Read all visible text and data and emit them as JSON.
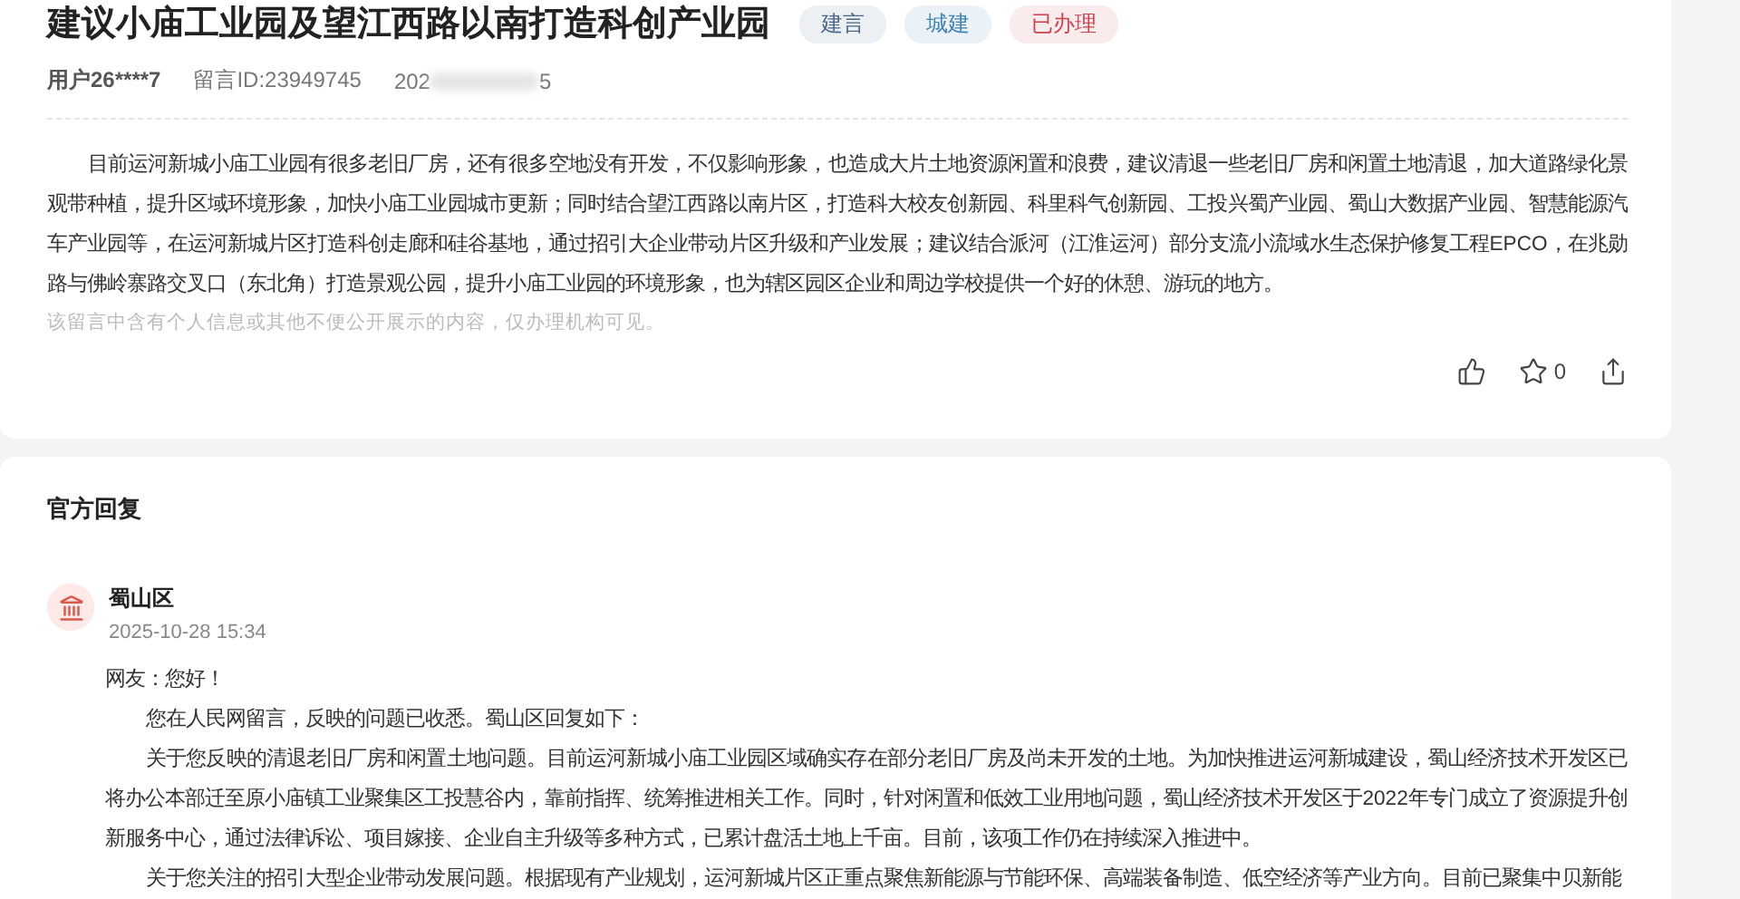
{
  "message": {
    "title": "建议小庙工业园及望江西路以南打造科创产业园",
    "tags": [
      {
        "label": "建言",
        "color": "#4a6a8a"
      },
      {
        "label": "城建",
        "color": "#3f84b0"
      },
      {
        "label": "已办理",
        "color": "#d0404a"
      }
    ],
    "user": "用户26****7",
    "message_id": "留言ID:23949745",
    "date_parts": [
      "202",
      "5"
    ],
    "body": "目前运河新城小庙工业园有很多老旧厂房，还有很多空地没有开发，不仅影响形象，也造成大片土地资源闲置和浪费，建议清退一些老旧厂房和闲置土地清退，加大道路绿化景观带种植，提升区域环境形象，加快小庙工业园城市更新；同时结合望江西路以南片区，打造科大校友创新园、科里科气创新园、工投兴蜀产业园、蜀山大数据产业园、智慧能源汽车产业园等，在运河新城片区打造科创走廊和硅谷基地，通过招引大企业带动片区升级和产业发展；建议结合派河（江淮运河）部分支流小流域水生态保护修复工程EPCO，在兆勋路与佛岭寨路交叉口（东北角）打造景观公园，提升小庙工业园的环境形象，也为辖区园区企业和周边学校提供一个好的休憩、游玩的地方。",
    "privacy_note": "该留言中含有个人信息或其他不便公开展示的内容，仅办理机构可见。",
    "star_count": "0"
  },
  "official_reply": {
    "heading": "官方回复",
    "responder": "蜀山区",
    "time": "2025-10-28 15:34",
    "greeting": "网友：您好！",
    "paragraphs": [
      "您在人民网留言，反映的问题已收悉。蜀山区回复如下：",
      "关于您反映的清退老旧厂房和闲置土地问题。目前运河新城小庙工业园区域确实存在部分老旧厂房及尚未开发的土地。为加快推进运河新城建设，蜀山经济技术开发区已将办公本部迁至原小庙镇工业聚集区工投慧谷内，靠前指挥、统筹推进相关工作。同时，针对闲置和低效工业用地问题，蜀山经济技术开发区于2022年专门成立了资源提升创新服务中心，通过法律诉讼、项目嫁接、企业自主升级等多种方式，已累计盘活土地上千亩。目前，该项工作仍在持续深入推进中。",
      "关于您关注的招引大型企业带动发展问题。根据现有产业规划，运河新城片区正重点聚焦新能源与节能环保、高端装备制造、低空经济等产业方向。目前已聚集中贝新能"
    ]
  }
}
